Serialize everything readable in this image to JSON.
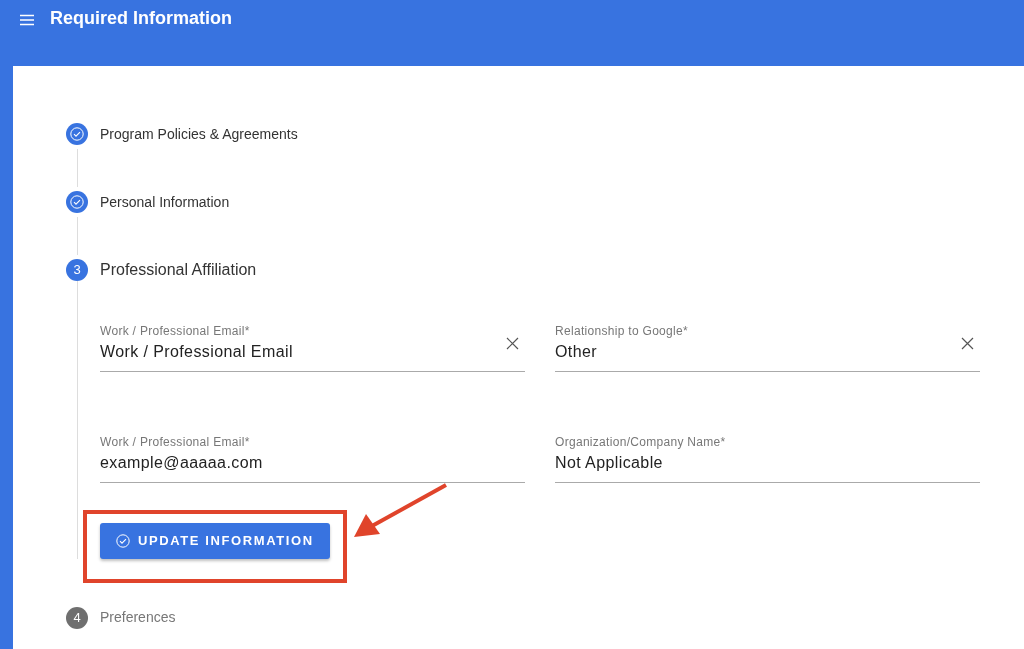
{
  "app_bar": {
    "title": "Required Information"
  },
  "steps": [
    {
      "label": "Program Policies & Agreements",
      "done": true,
      "selected": false
    },
    {
      "label": "Personal Information",
      "done": true,
      "selected": false
    },
    {
      "number": "3",
      "label": "Professional Affiliation",
      "done": false,
      "selected": true,
      "fields": [
        {
          "label": "Work / Professional Email*",
          "value": "Work / Professional Email",
          "clearable": true
        },
        {
          "label": "Relationship to Google*",
          "value": "Other",
          "clearable": true
        },
        {
          "label": "Work / Professional Email*",
          "value": "example@aaaaa.com",
          "clearable": false
        },
        {
          "label": "Organization/Company Name*",
          "value": "Not Applicable",
          "clearable": false
        }
      ],
      "button": "UPDATE INFORMATION"
    },
    {
      "number": "4",
      "label": "Preferences",
      "done": false,
      "selected": false
    }
  ],
  "annotation": {
    "highlight": true,
    "arrow": true
  }
}
